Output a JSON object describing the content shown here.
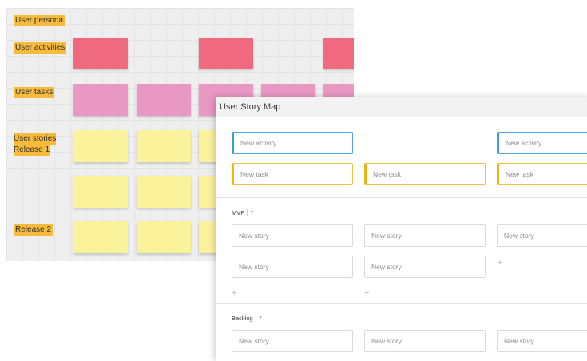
{
  "board": {
    "labels": {
      "persona": "User persona",
      "activities": "User activities",
      "tasks": "User tasks",
      "stories_line1": "User stories",
      "stories_line2": "Release 1",
      "release2": "Release 2"
    },
    "colors": {
      "label_bg": "#f7bb3c",
      "activity_note": "#ef6a7e",
      "task_note": "#e997c3",
      "story_note": "#fbf39c"
    }
  },
  "panel": {
    "title": "User Story Map",
    "activity_placeholder": "New activity",
    "task_placeholder": "New task",
    "story_placeholder": "New story",
    "add_symbol": "+",
    "sections": {
      "mvp": {
        "name": "MVP",
        "count": "7"
      },
      "backlog": {
        "name": "Backlog",
        "count": "7"
      }
    },
    "colors": {
      "activity_accent": "#3d9be0",
      "task_accent": "#f2b318"
    }
  }
}
